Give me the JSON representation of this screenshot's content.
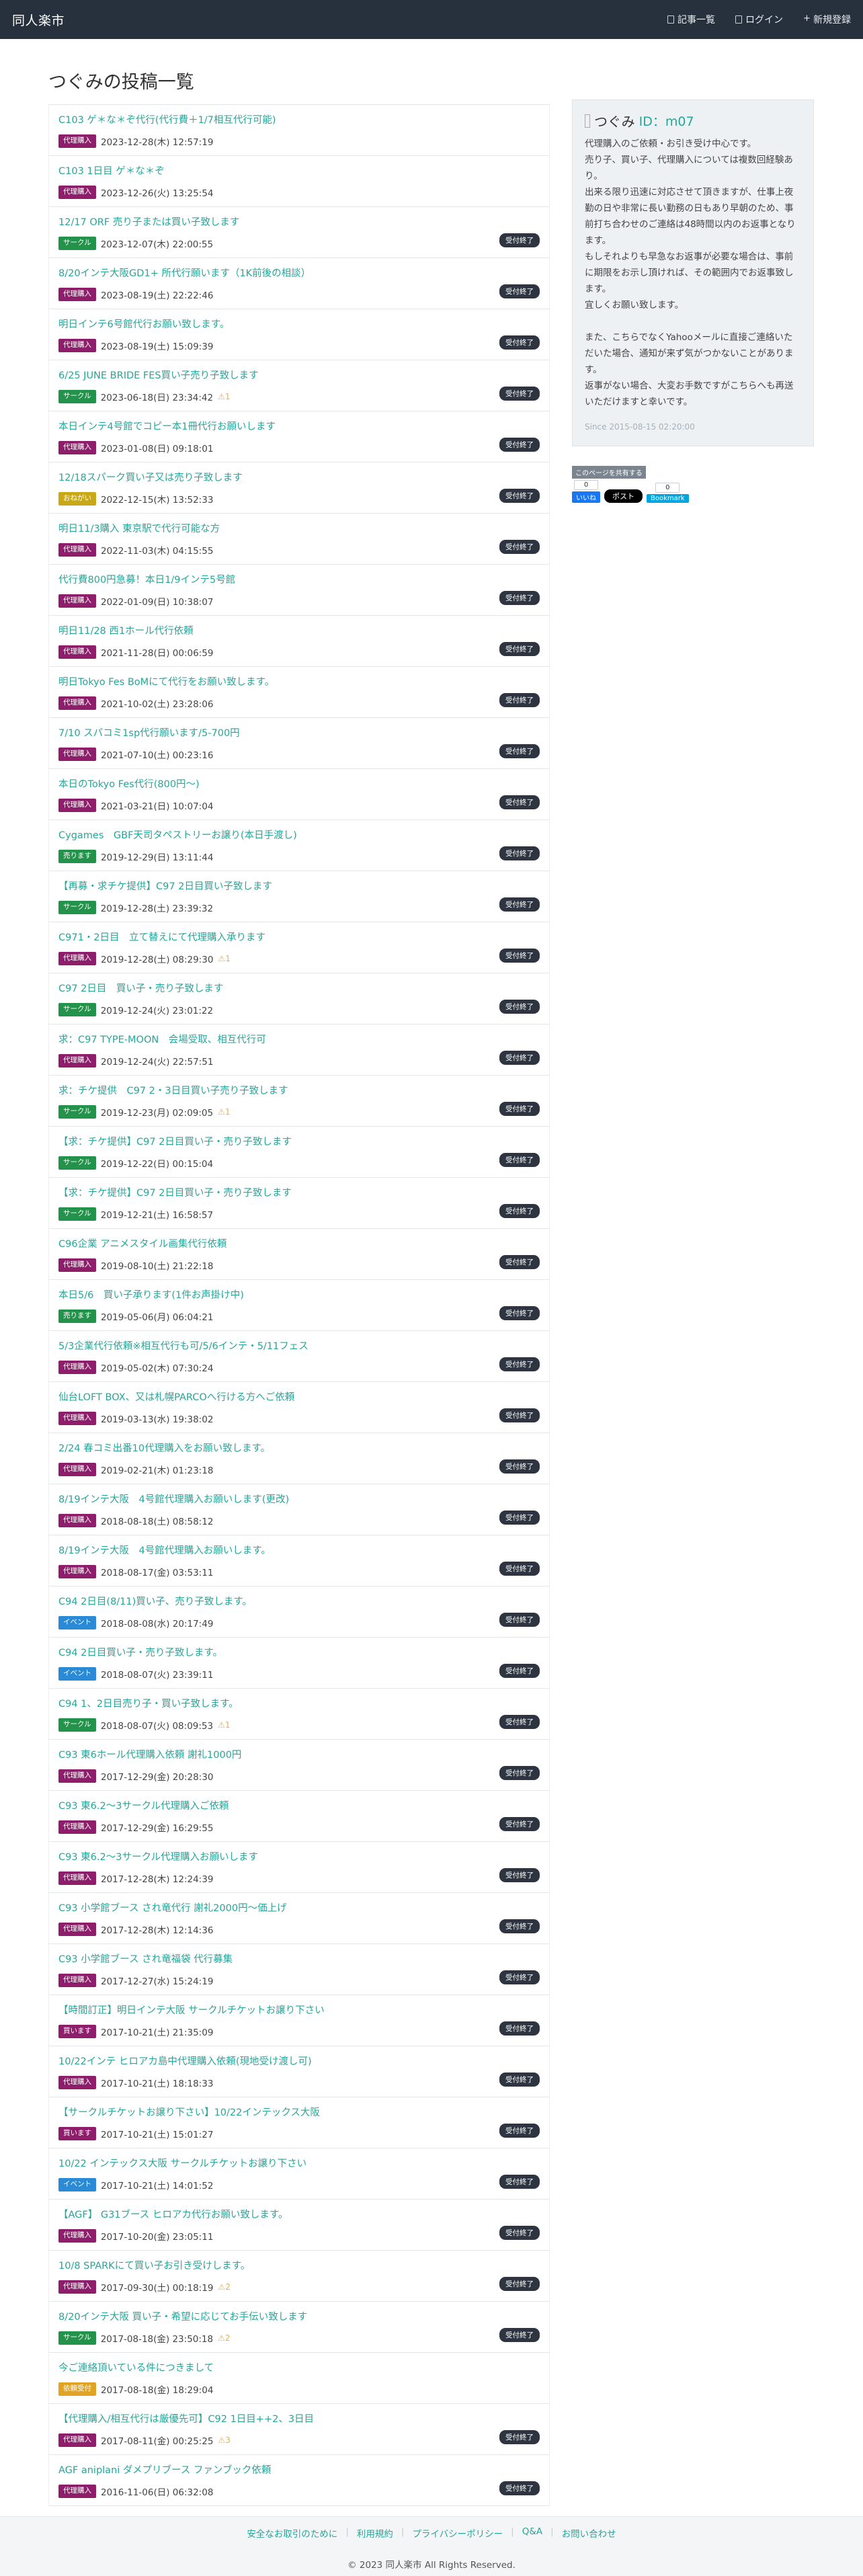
{
  "nav": {
    "brand": "同人楽市",
    "links": [
      "記事一覧",
      "ログイン",
      "新規登録"
    ]
  },
  "page_title": "つぐみの投稿一覧",
  "badge_colors": {
    "代理購入": "#8e1e6b",
    "サークル": "#23924a",
    "おねがい": "#c8a816",
    "売ります": "#23924a",
    "イベント": "#2b8ad6",
    "買います": "#8e1e6b",
    "依頼受付": "#e0a324"
  },
  "posts": [
    {
      "title": "C103 ゲ＊な＊ぞ代行(代行費＋1/7相互代行可能)",
      "badge": "代理購入",
      "date": "2023-12-28(木) 12:57:19",
      "warn": "",
      "status": ""
    },
    {
      "title": "C103 1日目 ゲ＊な＊ぞ",
      "badge": "代理購入",
      "date": "2023-12-26(火) 13:25:54",
      "warn": "",
      "status": ""
    },
    {
      "title": "12/17 ORF 売り子または買い子致します",
      "badge": "サークル",
      "date": "2023-12-07(木) 22:00:55",
      "warn": "",
      "status": "受付終了"
    },
    {
      "title": "8/20インテ大阪GD1+ 所代行願います（1K前後の相談）",
      "badge": "代理購入",
      "date": "2023-08-19(土) 22:22:46",
      "warn": "",
      "status": "受付終了"
    },
    {
      "title": "明日インテ6号館代行お願い致します。",
      "badge": "代理購入",
      "date": "2023-08-19(土) 15:09:39",
      "warn": "",
      "status": "受付終了"
    },
    {
      "title": "6/25 JUNE BRIDE FES買い子売り子致します",
      "badge": "サークル",
      "date": "2023-06-18(日) 23:34:42",
      "warn": "1",
      "status": "受付終了"
    },
    {
      "title": "本日インテ4号館でコピー本1冊代行お願いします",
      "badge": "代理購入",
      "date": "2023-01-08(日) 09:18:01",
      "warn": "",
      "status": "受付終了"
    },
    {
      "title": "12/18スパーク買い子又は売り子致します",
      "badge": "おねがい",
      "date": "2022-12-15(木) 13:52:33",
      "warn": "",
      "status": "受付終了"
    },
    {
      "title": "明日11/3購入 東京駅で代行可能な方",
      "badge": "代理購入",
      "date": "2022-11-03(木) 04:15:55",
      "warn": "",
      "status": "受付終了"
    },
    {
      "title": "代行費800円急募！本日1/9インテ5号館",
      "badge": "代理購入",
      "date": "2022-01-09(日) 10:38:07",
      "warn": "",
      "status": "受付終了"
    },
    {
      "title": "明日11/28 西1ホール代行依頼",
      "badge": "代理購入",
      "date": "2021-11-28(日) 00:06:59",
      "warn": "",
      "status": "受付終了"
    },
    {
      "title": "明日Tokyo Fes BoMにて代行をお願い致します。",
      "badge": "代理購入",
      "date": "2021-10-02(土) 23:28:06",
      "warn": "",
      "status": "受付終了"
    },
    {
      "title": "7/10 スパコミ1sp代行願います/5-700円",
      "badge": "代理購入",
      "date": "2021-07-10(土) 00:23:16",
      "warn": "",
      "status": "受付終了"
    },
    {
      "title": "本日のTokyo Fes代行(800円〜)",
      "badge": "代理購入",
      "date": "2021-03-21(日) 10:07:04",
      "warn": "",
      "status": "受付終了"
    },
    {
      "title": "Cygames　GBF天司タペストリーお譲り(本日手渡し)",
      "badge": "売ります",
      "date": "2019-12-29(日) 13:11:44",
      "warn": "",
      "status": "受付終了"
    },
    {
      "title": "【再募・求チケ提供】C97 2日目買い子致します",
      "badge": "サークル",
      "date": "2019-12-28(土) 23:39:32",
      "warn": "",
      "status": "受付終了"
    },
    {
      "title": "C971・2日目　立て替えにて代理購入承ります",
      "badge": "代理購入",
      "date": "2019-12-28(土) 08:29:30",
      "warn": "1",
      "status": "受付終了"
    },
    {
      "title": "C97 2日目　買い子・売り子致します",
      "badge": "サークル",
      "date": "2019-12-24(火) 23:01:22",
      "warn": "",
      "status": "受付終了"
    },
    {
      "title": "求：C97 TYPE-MOON　会場受取、相互代行可",
      "badge": "代理購入",
      "date": "2019-12-24(火) 22:57:51",
      "warn": "",
      "status": "受付終了"
    },
    {
      "title": "求：チケ提供　C97 2・3日目買い子売り子致します",
      "badge": "サークル",
      "date": "2019-12-23(月) 02:09:05",
      "warn": "1",
      "status": "受付終了"
    },
    {
      "title": "【求：チケ提供】C97 2日目買い子・売り子致します",
      "badge": "サークル",
      "date": "2019-12-22(日) 00:15:04",
      "warn": "",
      "status": "受付終了"
    },
    {
      "title": "【求：チケ提供】C97 2日目買い子・売り子致します",
      "badge": "サークル",
      "date": "2019-12-21(土) 16:58:57",
      "warn": "",
      "status": "受付終了"
    },
    {
      "title": "C96企業 アニメスタイル画集代行依頼",
      "badge": "代理購入",
      "date": "2019-08-10(土) 21:22:18",
      "warn": "",
      "status": "受付終了"
    },
    {
      "title": "本日5/6　買い子承ります(1件お声掛け中)",
      "badge": "売ります",
      "date": "2019-05-06(月) 06:04:21",
      "warn": "",
      "status": "受付終了"
    },
    {
      "title": "5/3企業代行依頼※相互代行も可/5/6インテ・5/11フェス",
      "badge": "代理購入",
      "date": "2019-05-02(木) 07:30:24",
      "warn": "",
      "status": "受付終了"
    },
    {
      "title": "仙台LOFT BOX、又は札幌PARCOへ行ける方へご依頼",
      "badge": "代理購入",
      "date": "2019-03-13(水) 19:38:02",
      "warn": "",
      "status": "受付終了"
    },
    {
      "title": "2/24 春コミ出番10代理購入をお願い致します。",
      "badge": "代理購入",
      "date": "2019-02-21(木) 01:23:18",
      "warn": "",
      "status": "受付終了"
    },
    {
      "title": "8/19インテ大阪　4号館代理購入お願いします(更改)",
      "badge": "代理購入",
      "date": "2018-08-18(土) 08:58:12",
      "warn": "",
      "status": "受付終了"
    },
    {
      "title": "8/19インテ大阪　4号館代理購入お願いします。",
      "badge": "代理購入",
      "date": "2018-08-17(金) 03:53:11",
      "warn": "",
      "status": "受付終了"
    },
    {
      "title": "C94 2日目(8/11)買い子、売り子致します。",
      "badge": "イベント",
      "date": "2018-08-08(水) 20:17:49",
      "warn": "",
      "status": "受付終了"
    },
    {
      "title": "C94 2日目買い子・売り子致します。",
      "badge": "イベント",
      "date": "2018-08-07(火) 23:39:11",
      "warn": "",
      "status": "受付終了"
    },
    {
      "title": "C94 1、2日目売り子・買い子致します。",
      "badge": "サークル",
      "date": "2018-08-07(火) 08:09:53",
      "warn": "1",
      "status": "受付終了"
    },
    {
      "title": "C93 東6ホール代理購入依頼 謝礼1000円",
      "badge": "代理購入",
      "date": "2017-12-29(金) 20:28:30",
      "warn": "",
      "status": "受付終了"
    },
    {
      "title": "C93 東6.2〜3サークル代理購入ご依頼",
      "badge": "代理購入",
      "date": "2017-12-29(金) 16:29:55",
      "warn": "",
      "status": "受付終了"
    },
    {
      "title": "C93 東6.2〜3サークル代理購入お願いします",
      "badge": "代理購入",
      "date": "2017-12-28(木) 12:24:39",
      "warn": "",
      "status": "受付終了"
    },
    {
      "title": "C93 小学館ブース され竜代行 謝礼2000円〜価上げ",
      "badge": "代理購入",
      "date": "2017-12-28(木) 12:14:36",
      "warn": "",
      "status": "受付終了"
    },
    {
      "title": "C93 小学館ブース され竜福袋 代行募集",
      "badge": "代理購入",
      "date": "2017-12-27(水) 15:24:19",
      "warn": "",
      "status": "受付終了"
    },
    {
      "title": "【時間訂正】明日インテ大阪 サークルチケットお譲り下さい",
      "badge": "買います",
      "date": "2017-10-21(土) 21:35:09",
      "warn": "",
      "status": "受付終了"
    },
    {
      "title": "10/22インテ ヒロアカ島中代理購入依頼(現地受け渡し可)",
      "badge": "代理購入",
      "date": "2017-10-21(土) 18:18:33",
      "warn": "",
      "status": "受付終了"
    },
    {
      "title": "【サークルチケットお譲り下さい】10/22インテックス大阪",
      "badge": "買います",
      "date": "2017-10-21(土) 15:01:27",
      "warn": "",
      "status": "受付終了"
    },
    {
      "title": "10/22 インテックス大阪 サークルチケットお譲り下さい",
      "badge": "イベント",
      "date": "2017-10-21(土) 14:01:52",
      "warn": "",
      "status": "受付終了"
    },
    {
      "title": "【AGF】 G31ブース ヒロアカ代行お願い致します。",
      "badge": "代理購入",
      "date": "2017-10-20(金) 23:05:11",
      "warn": "",
      "status": "受付終了"
    },
    {
      "title": "10/8 SPARKにて買い子お引き受けします。",
      "badge": "代理購入",
      "date": "2017-09-30(土) 00:18:19",
      "warn": "2",
      "status": "受付終了"
    },
    {
      "title": "8/20インテ大阪 買い子・希望に応じてお手伝い致します",
      "badge": "サークル",
      "date": "2017-08-18(金) 23:50:18",
      "warn": "2",
      "status": "受付終了"
    },
    {
      "title": "今ご連絡頂いている件につきまして",
      "badge": "依頼受付",
      "date": "2017-08-18(金) 18:29:04",
      "warn": "",
      "status": ""
    },
    {
      "title": "【代理購入/相互代行は厳優先可】C92 1日目++2、3日目",
      "badge": "代理購入",
      "date": "2017-08-11(金) 00:25:25",
      "warn": "3",
      "status": "受付終了"
    },
    {
      "title": "AGF aniplani ダメプリブース ファンブック依頼",
      "badge": "代理購入",
      "date": "2016-11-06(日) 06:32:08",
      "warn": "",
      "status": "受付終了"
    }
  ],
  "profile": {
    "name": "つぐみ",
    "id_label": "ID：m07",
    "text": "代理購入のご依頼・お引き受け中心です。\n売り子、買い子、代理購入については複数回経験あり。\n出来る限り迅速に対応させて頂きますが、仕事上夜勤の日や非常に長い勤務の日もあり早朝のため、事前打ち合わせのご連絡は48時間以内のお返事となります。\nもしそれよりも早急なお返事が必要な場合は、事前に期限をお示し頂ければ、その範囲内でお返事致します。\n宜しくお願い致します。\n\nまた、こちらでなくYahooメールに直接ご連絡いただいた場合、通知が来ず気がつかないことがあります。\n返事がない場合、大変お手数ですがこちらへも再送いただけますと幸いです。",
    "since": "Since 2015-08-15 02:20:00"
  },
  "share": {
    "label": "このページを共有する",
    "fb_count": "0",
    "fb_label": "いいね",
    "x_label": "ポスト",
    "hb_count": "0",
    "hb_label": "Bookmark"
  },
  "footer": {
    "links": [
      "安全なお取引のために",
      "利用規約",
      "プライバシーポリシー",
      "Q&A",
      "お問い合わせ"
    ],
    "copyright": "© 2023 同人楽市 All Rights Reserved."
  }
}
